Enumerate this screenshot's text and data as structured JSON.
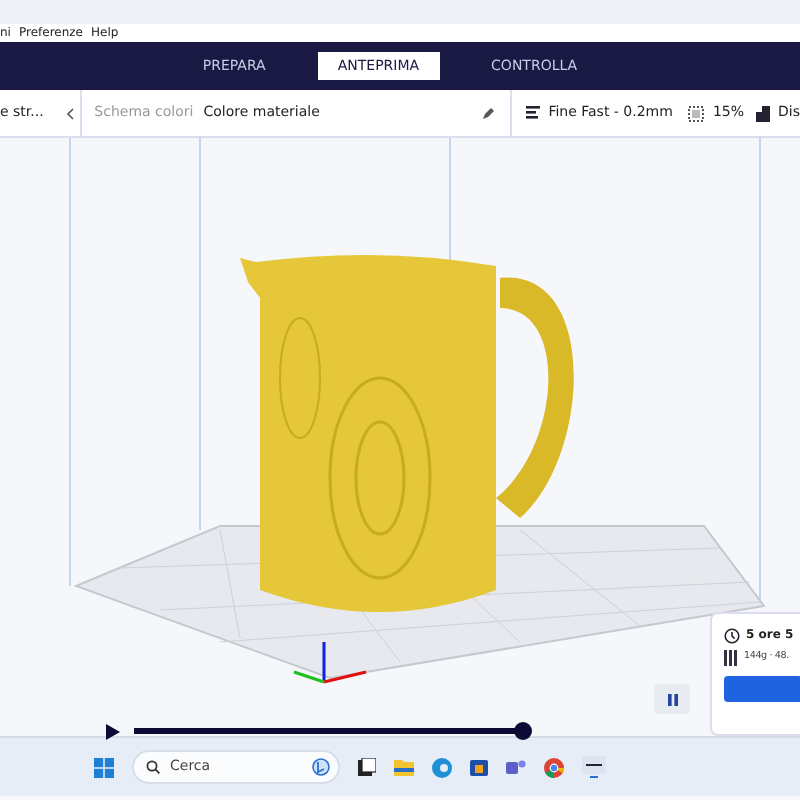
{
  "menu_bar": {
    "items": [
      "ni",
      "Preferenze",
      "Help"
    ]
  },
  "stages": [
    {
      "label": "PREPARA",
      "selected": false
    },
    {
      "label": "ANTEPRIMA",
      "selected": true
    },
    {
      "label": "CONTROLLA",
      "selected": false
    }
  ],
  "toolbar": {
    "view_type": "e str...",
    "color_scheme_label": "Schema colori",
    "color_scheme_value": "Colore materiale",
    "profile": "Fine Fast - 0.2mm",
    "infill": "15%",
    "support": "Dis"
  },
  "layer_slider": {
    "level": 1
  },
  "print_info": {
    "time": "5 ore 5",
    "material": "144g · 48."
  },
  "taskbar": {
    "search_placeholder": "Cerca"
  }
}
